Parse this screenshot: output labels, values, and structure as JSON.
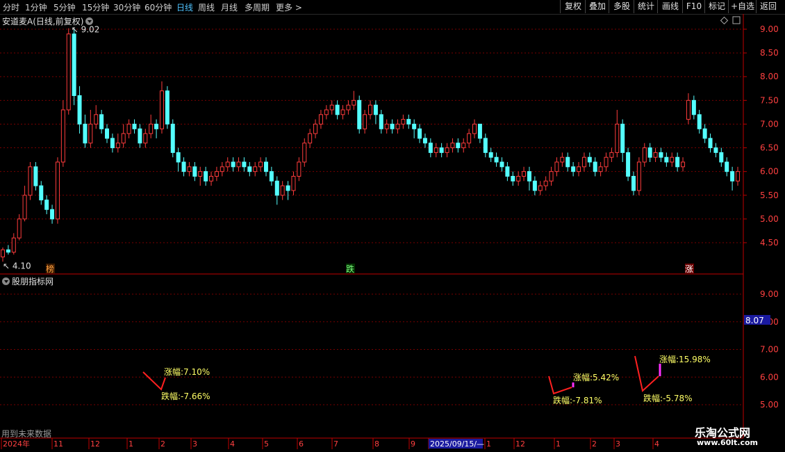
{
  "toolbar": {
    "periods": [
      "分时",
      "1分钟",
      "5分钟",
      "15分钟",
      "30分钟",
      "60分钟",
      "日线",
      "周线",
      "月线",
      "多周期",
      "更多 >"
    ],
    "active_period": "日线",
    "buttons": [
      "复权",
      "叠加",
      "多股",
      "统计",
      "画线",
      "F10",
      "标记",
      "+自选",
      "返回"
    ]
  },
  "chart_title": "安道麦A(日线,前复权)",
  "price_axis": [
    "9.00",
    "8.50",
    "8.00",
    "7.50",
    "7.00",
    "6.50",
    "6.00",
    "5.50",
    "5.00",
    "4.50"
  ],
  "indicator_axis": [
    "9.00",
    "8.00",
    "7.00",
    "6.00",
    "5.00"
  ],
  "indicator_value_box": "8.07",
  "price_annotations": {
    "high": "9.02",
    "low": "4.10"
  },
  "signals": [
    "榜",
    "跌",
    "涨"
  ],
  "indicator_name": "股朋指标网",
  "indicator_labels": [
    {
      "up": "涨幅:7.10%",
      "down": "跌幅:-7.66%"
    },
    {
      "up": "涨幅:5.42%",
      "down": "跌幅:-7.81%"
    },
    {
      "up": "涨幅:15.98%",
      "down": "跌幅:-5.78%"
    }
  ],
  "future_note": "用到未来数据",
  "time_axis": [
    "2024年",
    "11",
    "12",
    "1",
    "2",
    "3",
    "4",
    "5",
    "6",
    "7",
    "8",
    "9",
    "2025/09/15/—",
    "1",
    "12",
    "1",
    "2",
    "3",
    "4"
  ],
  "watermark": {
    "name": "乐淘公式网",
    "url": "www.60lt.com"
  },
  "colors": {
    "up": "#ff3c3c",
    "down": "#54ffff",
    "grid": "#7a0000",
    "axis": "#c00000",
    "label": "#ffff66",
    "magenta": "#ff30ff"
  },
  "chart_data": {
    "type": "candlestick",
    "title": "安道麦A(日线,前复权)",
    "ylim": [
      4.1,
      9.25
    ],
    "x_ticks": [
      "2024年",
      "11",
      "12",
      "1",
      "2",
      "3",
      "4",
      "5",
      "6",
      "7",
      "8",
      "9",
      "2025/09/15/—",
      "1",
      "12",
      "1",
      "2",
      "3",
      "4"
    ],
    "candles": [
      [
        4.2,
        4.35,
        4.1,
        4.4
      ],
      [
        4.35,
        4.3,
        4.25,
        4.45
      ],
      [
        4.3,
        4.6,
        4.25,
        4.7
      ],
      [
        4.6,
        5.0,
        4.55,
        5.1
      ],
      [
        5.0,
        5.5,
        4.95,
        5.7
      ],
      [
        5.5,
        6.1,
        5.4,
        6.2
      ],
      [
        6.1,
        5.7,
        5.6,
        6.2
      ],
      [
        5.7,
        5.4,
        5.3,
        5.8
      ],
      [
        5.4,
        5.2,
        5.1,
        5.5
      ],
      [
        5.2,
        5.0,
        4.9,
        5.3
      ],
      [
        5.0,
        6.2,
        4.9,
        6.3
      ],
      [
        6.2,
        7.3,
        6.1,
        7.5
      ],
      [
        7.3,
        8.9,
        7.2,
        9.02
      ],
      [
        8.9,
        7.6,
        7.4,
        9.0
      ],
      [
        7.6,
        7.0,
        6.8,
        7.8
      ],
      [
        7.0,
        6.6,
        6.5,
        7.2
      ],
      [
        6.6,
        7.0,
        6.5,
        7.3
      ],
      [
        7.0,
        7.2,
        6.9,
        7.4
      ],
      [
        7.2,
        6.9,
        6.8,
        7.3
      ],
      [
        6.9,
        6.7,
        6.6,
        7.0
      ],
      [
        6.7,
        6.5,
        6.4,
        6.8
      ],
      [
        6.5,
        6.6,
        6.4,
        6.8
      ],
      [
        6.6,
        6.8,
        6.5,
        7.0
      ],
      [
        6.8,
        7.0,
        6.7,
        7.1
      ],
      [
        7.0,
        6.9,
        6.8,
        7.1
      ],
      [
        6.9,
        6.6,
        6.5,
        7.0
      ],
      [
        6.6,
        6.8,
        6.5,
        6.9
      ],
      [
        6.8,
        7.0,
        6.7,
        7.2
      ],
      [
        7.0,
        6.9,
        6.7,
        7.1
      ],
      [
        6.9,
        7.7,
        6.8,
        7.9
      ],
      [
        7.7,
        7.0,
        6.9,
        7.8
      ],
      [
        7.0,
        6.4,
        6.3,
        7.1
      ],
      [
        6.4,
        6.2,
        6.0,
        6.5
      ],
      [
        6.2,
        6.0,
        5.9,
        6.3
      ],
      [
        6.0,
        6.1,
        5.9,
        6.2
      ],
      [
        6.1,
        5.9,
        5.8,
        6.2
      ],
      [
        5.9,
        6.0,
        5.7,
        6.1
      ],
      [
        6.0,
        5.8,
        5.7,
        6.1
      ],
      [
        5.8,
        5.9,
        5.7,
        6.0
      ],
      [
        5.9,
        6.0,
        5.8,
        6.1
      ],
      [
        6.0,
        6.1,
        5.9,
        6.2
      ],
      [
        6.1,
        6.2,
        6.0,
        6.3
      ],
      [
        6.2,
        6.1,
        6.0,
        6.3
      ],
      [
        6.1,
        6.2,
        6.0,
        6.3
      ],
      [
        6.2,
        6.1,
        6.0,
        6.3
      ],
      [
        6.1,
        6.0,
        5.9,
        6.2
      ],
      [
        6.0,
        6.1,
        5.9,
        6.2
      ],
      [
        6.1,
        6.2,
        6.0,
        6.3
      ],
      [
        6.2,
        6.0,
        5.9,
        6.3
      ],
      [
        6.0,
        5.8,
        5.7,
        6.1
      ],
      [
        5.8,
        5.5,
        5.3,
        5.9
      ],
      [
        5.5,
        5.7,
        5.4,
        5.8
      ],
      [
        5.7,
        5.6,
        5.4,
        5.8
      ],
      [
        5.6,
        5.9,
        5.5,
        6.0
      ],
      [
        5.9,
        6.2,
        5.8,
        6.3
      ],
      [
        6.2,
        6.6,
        6.1,
        6.7
      ],
      [
        6.6,
        6.8,
        6.5,
        6.9
      ],
      [
        6.8,
        7.0,
        6.7,
        7.1
      ],
      [
        7.0,
        7.2,
        6.9,
        7.3
      ],
      [
        7.2,
        7.3,
        7.1,
        7.4
      ],
      [
        7.3,
        7.4,
        7.2,
        7.5
      ],
      [
        7.4,
        7.2,
        7.1,
        7.5
      ],
      [
        7.2,
        7.3,
        7.1,
        7.4
      ],
      [
        7.3,
        7.4,
        7.2,
        7.5
      ],
      [
        7.4,
        7.5,
        7.3,
        7.7
      ],
      [
        7.5,
        6.9,
        6.8,
        7.6
      ],
      [
        6.9,
        7.2,
        6.8,
        7.3
      ],
      [
        7.2,
        7.4,
        7.1,
        7.5
      ],
      [
        7.4,
        7.2,
        7.0,
        7.5
      ],
      [
        7.2,
        6.9,
        6.8,
        7.3
      ],
      [
        6.9,
        7.0,
        6.8,
        7.1
      ],
      [
        7.0,
        6.9,
        6.8,
        7.1
      ],
      [
        6.9,
        7.0,
        6.8,
        7.1
      ],
      [
        7.0,
        7.1,
        6.9,
        7.2
      ],
      [
        7.1,
        7.0,
        6.9,
        7.2
      ],
      [
        7.0,
        6.9,
        6.7,
        7.1
      ],
      [
        6.9,
        6.7,
        6.6,
        7.0
      ],
      [
        6.7,
        6.6,
        6.5,
        6.8
      ],
      [
        6.6,
        6.4,
        6.3,
        6.7
      ],
      [
        6.4,
        6.5,
        6.3,
        6.6
      ],
      [
        6.5,
        6.4,
        6.3,
        6.6
      ],
      [
        6.4,
        6.5,
        6.3,
        6.6
      ],
      [
        6.5,
        6.6,
        6.4,
        6.7
      ],
      [
        6.6,
        6.5,
        6.4,
        6.7
      ],
      [
        6.5,
        6.6,
        6.4,
        6.7
      ],
      [
        6.6,
        6.8,
        6.5,
        6.9
      ],
      [
        6.8,
        7.0,
        6.7,
        7.1
      ],
      [
        7.0,
        6.7,
        6.6,
        7.0
      ],
      [
        6.7,
        6.4,
        6.3,
        6.8
      ],
      [
        6.4,
        6.3,
        6.2,
        6.5
      ],
      [
        6.3,
        6.2,
        6.1,
        6.4
      ],
      [
        6.2,
        6.1,
        6.0,
        6.3
      ],
      [
        6.1,
        5.9,
        5.8,
        6.2
      ],
      [
        5.9,
        5.8,
        5.7,
        6.0
      ],
      [
        5.8,
        5.9,
        5.7,
        6.0
      ],
      [
        5.9,
        6.0,
        5.8,
        6.1
      ],
      [
        6.0,
        5.8,
        5.6,
        6.1
      ],
      [
        5.8,
        5.6,
        5.5,
        5.9
      ],
      [
        5.6,
        5.7,
        5.5,
        5.8
      ],
      [
        5.7,
        5.8,
        5.6,
        5.9
      ],
      [
        5.8,
        6.0,
        5.7,
        6.1
      ],
      [
        6.0,
        6.2,
        5.9,
        6.3
      ],
      [
        6.2,
        6.3,
        6.1,
        6.4
      ],
      [
        6.3,
        6.1,
        6.0,
        6.4
      ],
      [
        6.1,
        6.0,
        5.9,
        6.2
      ],
      [
        6.0,
        6.1,
        5.9,
        6.2
      ],
      [
        6.1,
        6.3,
        6.0,
        6.4
      ],
      [
        6.3,
        6.2,
        6.1,
        6.4
      ],
      [
        6.2,
        6.0,
        5.9,
        6.3
      ],
      [
        6.0,
        6.1,
        5.9,
        6.2
      ],
      [
        6.1,
        6.3,
        6.0,
        6.4
      ],
      [
        6.3,
        6.4,
        6.2,
        6.5
      ],
      [
        6.4,
        7.0,
        6.3,
        7.3
      ],
      [
        7.0,
        6.4,
        6.2,
        7.1
      ],
      [
        6.4,
        5.9,
        5.8,
        6.5
      ],
      [
        5.9,
        5.6,
        5.5,
        6.0
      ],
      [
        5.6,
        6.2,
        5.5,
        6.3
      ],
      [
        6.2,
        6.5,
        6.1,
        6.6
      ],
      [
        6.5,
        6.3,
        6.2,
        6.6
      ],
      [
        6.3,
        6.4,
        6.2,
        6.5
      ],
      [
        6.4,
        6.3,
        6.2,
        6.5
      ],
      [
        6.3,
        6.2,
        6.1,
        6.4
      ],
      [
        6.2,
        6.3,
        6.1,
        6.4
      ],
      [
        6.3,
        6.1,
        6.0,
        6.4
      ],
      [
        6.1,
        6.2,
        6.0,
        6.3
      ],
      [
        7.1,
        7.5,
        7.0,
        7.65
      ],
      [
        7.5,
        7.2,
        7.1,
        7.6
      ],
      [
        7.2,
        6.9,
        6.8,
        7.3
      ],
      [
        6.9,
        6.7,
        6.6,
        7.0
      ],
      [
        6.7,
        6.5,
        6.4,
        6.8
      ],
      [
        6.5,
        6.4,
        6.3,
        6.6
      ],
      [
        6.4,
        6.2,
        6.1,
        6.5
      ],
      [
        6.2,
        6.0,
        5.9,
        6.3
      ],
      [
        6.0,
        5.8,
        5.6,
        6.1
      ],
      [
        5.8,
        6.0,
        5.7,
        6.1
      ]
    ],
    "indicator_lines": [
      {
        "color": "red",
        "points": [
          [
            6.25
          ],
          [
            5.85
          ],
          [
            6.1
          ]
        ]
      }
    ]
  }
}
